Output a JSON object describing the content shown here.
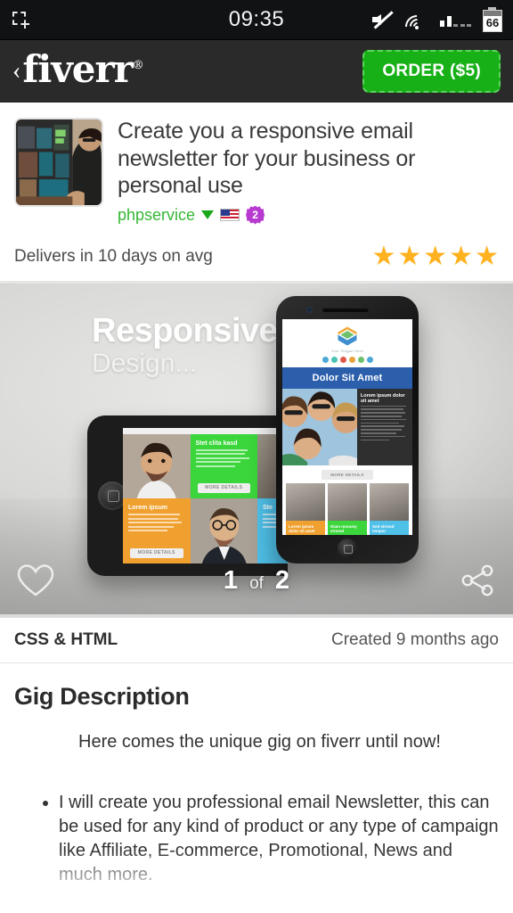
{
  "status_bar": {
    "left_icon": "screenshot-crop-icon",
    "time": "09:35",
    "icons": [
      "mute-icon",
      "wifi-icon",
      "signal-icon"
    ],
    "battery_level": "66"
  },
  "nav": {
    "back_label": "‹",
    "brand": "fiverr",
    "brand_mark": "®",
    "order_button": "ORDER ($5)",
    "accent_green": "#17b117"
  },
  "gig": {
    "thumbnail_alt": "seller-avatar",
    "title": "Create you a responsive email newsletter for your business or personal use",
    "seller": "phpservice",
    "seller_color": "#35b735",
    "country_flag": "us-flag-icon",
    "level_badge": "2",
    "level_badge_color": "#b83ad1",
    "delivery": "Delivers in 10 days on avg",
    "rating_stars": 5,
    "star_color": "#ffb21f"
  },
  "gallery": {
    "headline_1": "Responsive",
    "headline_2": "Design...",
    "phone_banner": "Dolor Sit Amet",
    "phone_tagline": "Your Slogan Here",
    "phone_side_heading": "Lorem ipsum dolor sit amet",
    "more_details": "MORE DETAILS",
    "tablet_cards": [
      {
        "heading": "Stet clita kasd",
        "color": "#3bd63b"
      },
      {
        "heading": "Lorem ipsum",
        "color": "#f0a02e"
      },
      {
        "heading": "Ste",
        "color": "#4fc0e8"
      }
    ],
    "phone_cards": [
      {
        "heading": "Lorem ipsum dolor sit amet",
        "stars": "★★★★★",
        "color": "#f0a02e"
      },
      {
        "heading": "Diam nonumy eirmod",
        "stars": "★★★★★",
        "color": "#3bd63b"
      },
      {
        "heading": "Sed eirmod tempor",
        "stars": "★★★★★",
        "color": "#4fc0e8"
      }
    ],
    "favorite_icon": "heart-icon",
    "share_icon": "share-icon",
    "page_current": "1",
    "page_of": "of",
    "page_total": "2"
  },
  "meta": {
    "category": "CSS & HTML",
    "created": "Created 9 months ago"
  },
  "description": {
    "heading": "Gig Description",
    "intro": "Here comes the unique gig on fiverr until now!",
    "bullets": [
      "I will create you professional email Newsletter, this can be used for any kind of product or any type of campaign like Affiliate, E-commerce, Promotional, News and much more."
    ]
  }
}
